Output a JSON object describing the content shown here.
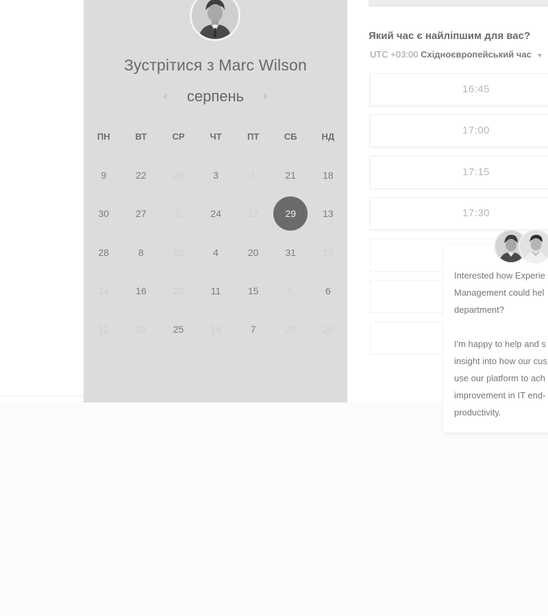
{
  "calendar": {
    "title": "Зустрітися з Marc Wilson",
    "month": "серпень",
    "prev_icon": "chevron-left-icon",
    "next_icon": "chevron-right-icon",
    "weekdays": [
      "ПН",
      "ВТ",
      "СР",
      "ЧТ",
      "ПТ",
      "СБ",
      "НД"
    ],
    "weeks": [
      [
        "9",
        "22",
        "26",
        "3",
        "1",
        "21",
        "18"
      ],
      [
        "30",
        "27",
        "2",
        "24",
        "17",
        "29",
        "13"
      ],
      [
        "28",
        "8",
        "10",
        "4",
        "20",
        "31",
        "19"
      ],
      [
        "14",
        "16",
        "23",
        "11",
        "15",
        "5",
        "6"
      ],
      [
        "12",
        "10",
        "25",
        "19",
        "7",
        "26",
        "20"
      ]
    ],
    "selected_day": "29"
  },
  "scheduler": {
    "question": "Який час є найліпшим для вас?",
    "timezone_offset": "UTC +03:00",
    "timezone_name": "Східноєвропейський час",
    "slots": [
      "16:45",
      "17:00",
      "17:15",
      "17:30",
      "",
      "",
      ""
    ]
  },
  "chat": {
    "paragraph1": "Interested how Experie\nManagement could hel\ndepartment?",
    "paragraph2": "I'm happy to help and s\ninsight into how our cus\nuse our platform to ach\nimprovement in IT end-\nproductivity."
  },
  "colors": {
    "panel": "#dcdcdc",
    "selected": "#6b6b6b",
    "text": "#6a6a6a"
  }
}
